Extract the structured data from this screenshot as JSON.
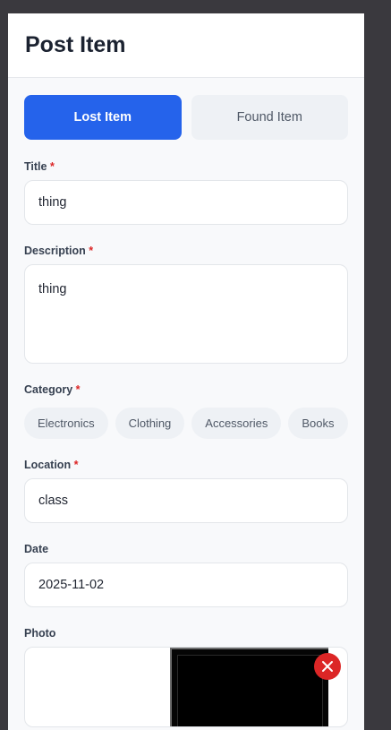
{
  "header": {
    "title": "Post Item"
  },
  "type_toggle": {
    "lost_label": "Lost Item",
    "found_label": "Found Item",
    "selected": "Lost Item"
  },
  "form": {
    "title": {
      "label": "Title",
      "required_mark": "*",
      "value": "thing"
    },
    "description": {
      "label": "Description",
      "required_mark": "*",
      "value": "thing"
    },
    "category": {
      "label": "Category",
      "required_mark": "*",
      "options": [
        "Electronics",
        "Clothing",
        "Accessories",
        "Books"
      ]
    },
    "location": {
      "label": "Location",
      "required_mark": "*",
      "value": "class"
    },
    "date": {
      "label": "Date",
      "value": "2025-11-02"
    },
    "photo": {
      "label": "Photo",
      "remove_icon": "close-icon"
    }
  },
  "colors": {
    "accent": "#2563eb",
    "required": "#dc2626",
    "remove": "#dc2626"
  }
}
